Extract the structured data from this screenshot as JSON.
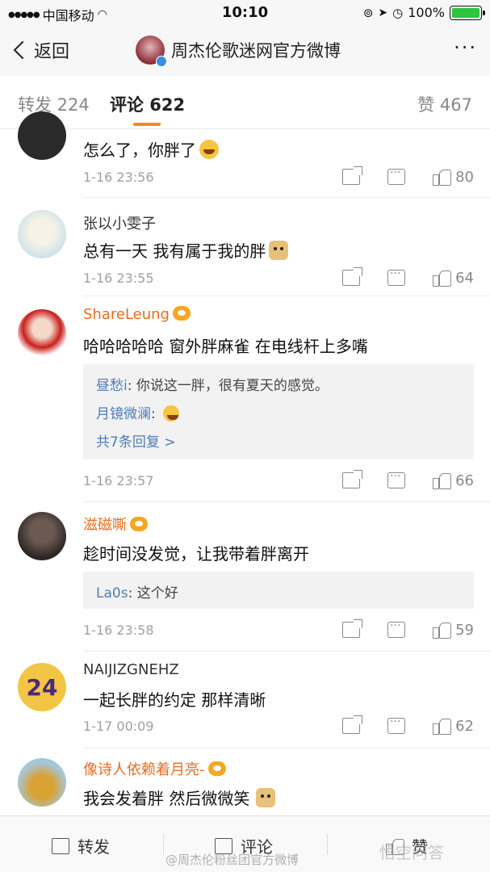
{
  "status_bar": {
    "carrier": "中国移动",
    "time": "10:10",
    "battery_percent": "100%",
    "battery_level": 1.0
  },
  "nav": {
    "back_label": "返回",
    "title": "周杰伦歌迷网官方微博",
    "more_label": "···"
  },
  "tabs": [
    {
      "label": "转发 224"
    },
    {
      "label": "评论 622"
    },
    {
      "label": "赞 467"
    }
  ],
  "comments": [
    {
      "name": "",
      "text": "怎么了，你胖了",
      "emoji": "laugh-icon",
      "time": "1-16 23:56",
      "likes": "80"
    },
    {
      "name": "张以小雯子",
      "text": "总有一天 我有属于我的胖",
      "emoji": "doge-icon",
      "time": "1-16 23:55",
      "likes": "64"
    },
    {
      "name": "ShareLeung",
      "text": "哈哈哈哈哈    窗外胖麻雀   在电线杆上多嘴",
      "time": "1-16 23:57",
      "likes": "66",
      "replies": [
        {
          "user": "昼愁i",
          "text": ": 你说这一胖，很有夏天的感觉。"
        },
        {
          "user": "月镜微澜",
          "text": ": "
        }
      ],
      "more": "共7条回复 >"
    },
    {
      "name": "滋磁嘶",
      "text": "趁时间没发觉，让我带着胖离开",
      "time": "1-16 23:58",
      "likes": "59",
      "replies": [
        {
          "user": "La0s",
          "text": ": 这个好"
        }
      ]
    },
    {
      "name": "NAIJIZGNEHZ",
      "text": "一起长胖的约定 那样清晰",
      "time": "1-17 00:09",
      "likes": "62"
    },
    {
      "name": "像诗人依赖着月亮-",
      "text": "我会发着胖  然后微微笑"
    }
  ],
  "bottom_bar": {
    "repost": "转发",
    "comment": "评论",
    "like": "赞",
    "watermark": "@周杰伦粉丝团官方微博",
    "watermark2": "悟空问答"
  },
  "colors": {
    "accent": "#f08a24",
    "name_orange": "#e86d1f",
    "reply_link": "#4f7db5"
  }
}
